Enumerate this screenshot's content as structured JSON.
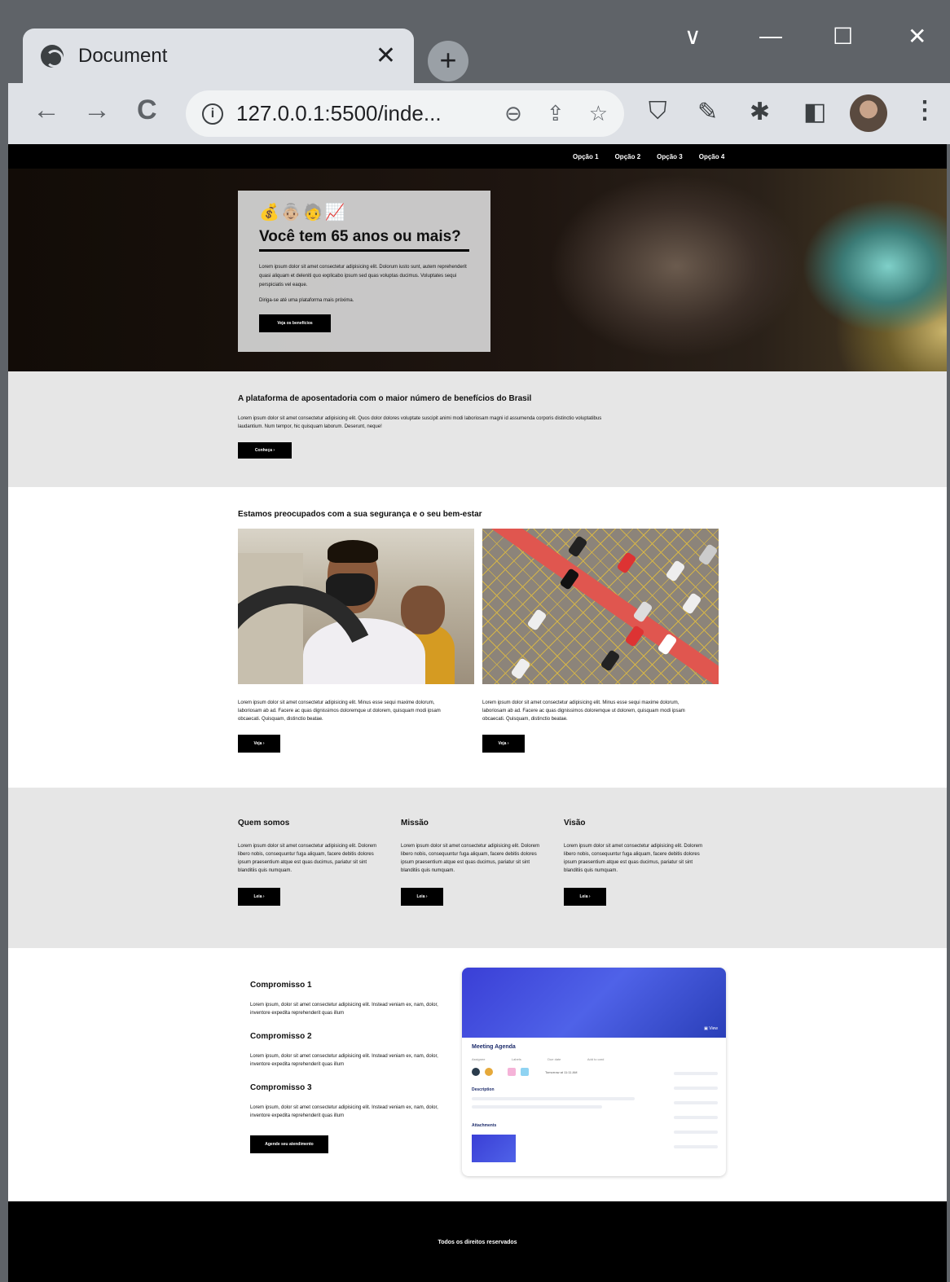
{
  "browser": {
    "tab_title": "Document",
    "tab_close": "✕",
    "new_tab": "+",
    "url": "127.0.0.1:5500/inde...",
    "back": "←",
    "forward": "→",
    "reload": "C",
    "zoom_icon": "⊖",
    "share_icon": "⇪",
    "star_icon": "☆",
    "window": {
      "chevron": "∨",
      "minimize": "—",
      "maximize": "☐",
      "close": "✕"
    }
  },
  "nav": {
    "items": [
      "Opção 1",
      "Opção 2",
      "Opção 3",
      "Opção 4"
    ]
  },
  "hero": {
    "icons": "💰👵🏼🧓📈",
    "title": "Você tem 65 anos ou mais?",
    "text": "Lorem ipsum dolor sit amet consectetur adipisicing elit. Dolorum iusto sunt, autem reprehenderit quasi aliquam et deleniti quo explicabo ipsum sed quas voluptas ducimus. Voluptates sequi perspiciatis vel eaque.",
    "subtext": "Diriga-se até uma plataforma mais próxima.",
    "button": "Veja os benefícios"
  },
  "platform": {
    "title": "A plataforma de aposentadoria com o maior número de benefícios do Brasil",
    "text": "Lorem ipsum dolor sit amet consectetur adipisicing elit. Quos dolor dolores voluptate suscipit animi modi laboriosam magni id assumenda corporis distinctio voluptatibus laudantium. Num tempor, hic quisquam laborum. Deserunt, neque!",
    "button": "Conheça ›"
  },
  "safety": {
    "title": "Estamos preocupados com a sua segurança e o seu bem-estar",
    "cards": [
      {
        "text": "Lorem ipsum dolor sit amet consectetur adipisicing elit. Minus esse sequi maxime dolorum, laboriosam ab ad. Facere ac quas dignissimos doloremque ut dolorem, quisquam modi ipsam obcaecati. Quisquam, distinctio beatae.",
        "button": "Veja ›"
      },
      {
        "text": "Lorem ipsum dolor sit amet consectetur adipisicing elit. Minus esse sequi maxime dolorum, laboriosam ab ad. Facere ac quas dignissimos doloremque ut dolorem, quisquam modi ipsam obcaecati. Quisquam, distinctio beatae.",
        "button": "Veja ›"
      }
    ]
  },
  "about": {
    "cols": [
      {
        "title": "Quem somos",
        "text": "Lorem ipsum dolor sit amet consectetur adipisicing elit. Dolorem libero nobis, consequuntur fuga aliquam, facere debitis dolores ipsum praesentium atque est quas ducimus, pariatur sit sint blanditiis quis numquam.",
        "button": "Leia ›"
      },
      {
        "title": "Missão",
        "text": "Lorem ipsum dolor sit amet consectetur adipisicing elit. Dolorem libero nobis, consequuntur fuga aliquam, facere debitis dolores ipsum praesentium atque est quas ducimus, pariatur sit sint blanditiis quis numquam.",
        "button": "Leia ›"
      },
      {
        "title": "Visão",
        "text": "Lorem ipsum dolor sit amet consectetur adipisicing elit. Dolorem libero nobis, consequuntur fuga aliquam, facere debitis dolores ipsum praesentium atque est quas ducimus, pariatur sit sint blanditiis quis numquam.",
        "button": "Leia ›"
      }
    ]
  },
  "commitments": {
    "items": [
      {
        "title": "Compromisso 1",
        "text": "Lorem ipsum, dolor sit amet consectetur adipisicing elit. Instead veniam ex, nam, dolor, inventore expedita reprehenderit quas illum"
      },
      {
        "title": "Compromisso 2",
        "text": "Lorem ipsum, dolor sit amet consectetur adipisicing elit. Instead veniam ex, nam, dolor, inventore expedita reprehenderit quas illum"
      },
      {
        "title": "Compromisso 3",
        "text": "Lorem ipsum, dolor sit amet consectetur adipisicing elit. Instead veniam ex, nam, dolor, inventore expedita reprehenderit quas illum"
      }
    ],
    "button": "Agende seu atendimento",
    "screenshot": {
      "view_label": "▣ View",
      "title": "Meeting Agenda",
      "labels": [
        "Assignee",
        "Labels",
        "Due date",
        "Add to card"
      ],
      "due": "Tomorrow at 11:11 AM",
      "description": "Description",
      "attachments": "Attachments"
    }
  },
  "footer": {
    "text": "Todos os direitos reservados"
  },
  "colors": {
    "chrome_dark": "#5f6368",
    "chrome_light": "#dee1e6",
    "section_grey": "#e6e6e6",
    "black": "#000000"
  }
}
